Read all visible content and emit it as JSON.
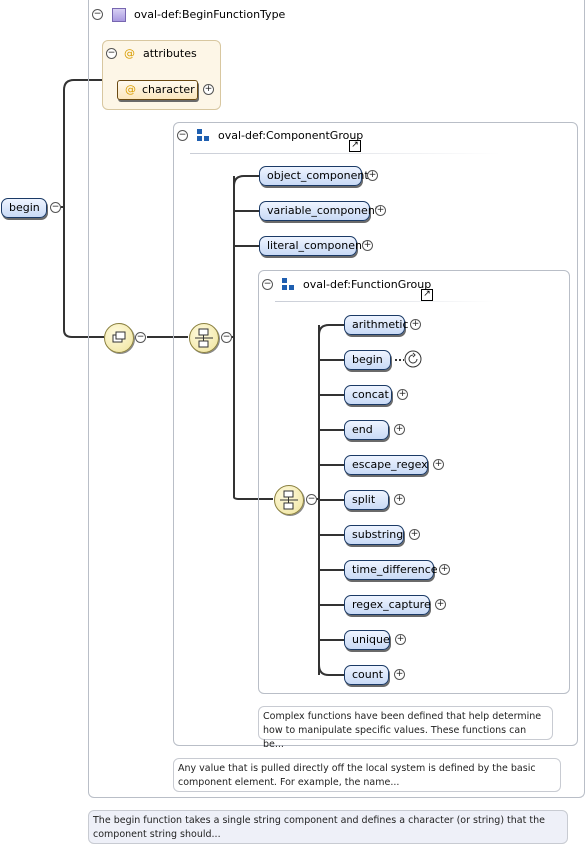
{
  "root": {
    "element": "begin",
    "type_header": "oval-def:BeginFunctionType",
    "documentation": "The begin function takes a single string component and defines a character (or string) that the component string should..."
  },
  "attributes": {
    "header": "attributes",
    "items": [
      {
        "label": "character"
      }
    ]
  },
  "component_group": {
    "header": "oval-def:ComponentGroup",
    "items": [
      {
        "label": "object_component"
      },
      {
        "label": "variable_component"
      },
      {
        "label": "literal_component"
      }
    ],
    "documentation": "Any value that is pulled directly off the local system is defined by the basic component element. For example, the name..."
  },
  "function_group": {
    "header": "oval-def:FunctionGroup",
    "items": [
      {
        "label": "arithmetic"
      },
      {
        "label": "begin"
      },
      {
        "label": "concat"
      },
      {
        "label": "end"
      },
      {
        "label": "escape_regex"
      },
      {
        "label": "split"
      },
      {
        "label": "substring"
      },
      {
        "label": "time_difference"
      },
      {
        "label": "regex_capture"
      },
      {
        "label": "unique"
      },
      {
        "label": "count"
      }
    ],
    "documentation": "Complex functions have been defined that help determine how to manipulate specific values. These functions can be..."
  },
  "colors": {
    "node_fill": "#c9daf6",
    "node_border": "#1b3a66",
    "attribute_fill": "#fdf3dd",
    "attribute_border": "#c08a2a",
    "compositor_fill": "#efe39a",
    "frame_border": "#b9bec7",
    "line": "#333333"
  },
  "icons": {
    "type": "complex-type-icon",
    "attribute": "at-sign-icon",
    "group": "group-icon",
    "sequence": "sequence-compositor-icon",
    "choice": "choice-compositor-icon",
    "recursion": "recursion-icon",
    "link": "link-arrow-icon"
  }
}
